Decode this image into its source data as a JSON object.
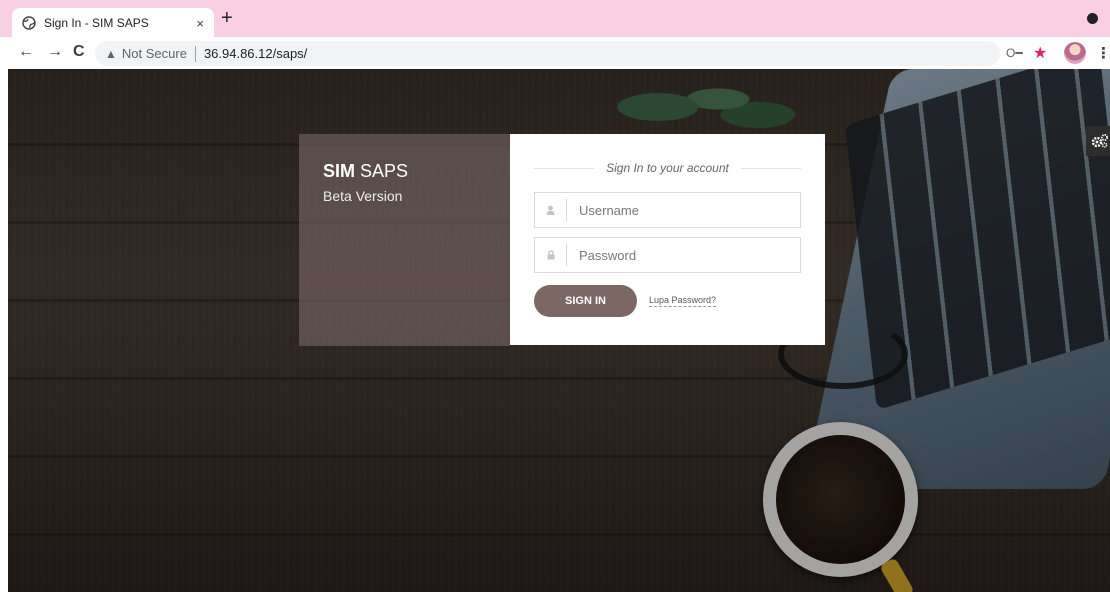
{
  "browser": {
    "tab_title": "Sign In - SIM SAPS",
    "tab_close": "×",
    "new_tab": "+",
    "not_secure": "Not Secure",
    "url": "36.94.86.12/saps/"
  },
  "app": {
    "name_bold": "SIM",
    "name_rest": " SAPS",
    "version": "Beta Version"
  },
  "login": {
    "heading": "Sign In to your account",
    "username_placeholder": "Username",
    "password_placeholder": "Password",
    "signin_label": "SIGN IN",
    "forgot_label": "Lupa Password?"
  },
  "colors": {
    "tabbar": "#f8cfe3",
    "signin_button": "#7d6764",
    "star": "#e91e63"
  },
  "icons": [
    "globe-icon",
    "back-icon",
    "forward-icon",
    "reload-icon",
    "warning-icon",
    "key-icon",
    "star-icon",
    "kebab-menu-icon",
    "gear-icon",
    "user-icon",
    "lock-icon"
  ]
}
